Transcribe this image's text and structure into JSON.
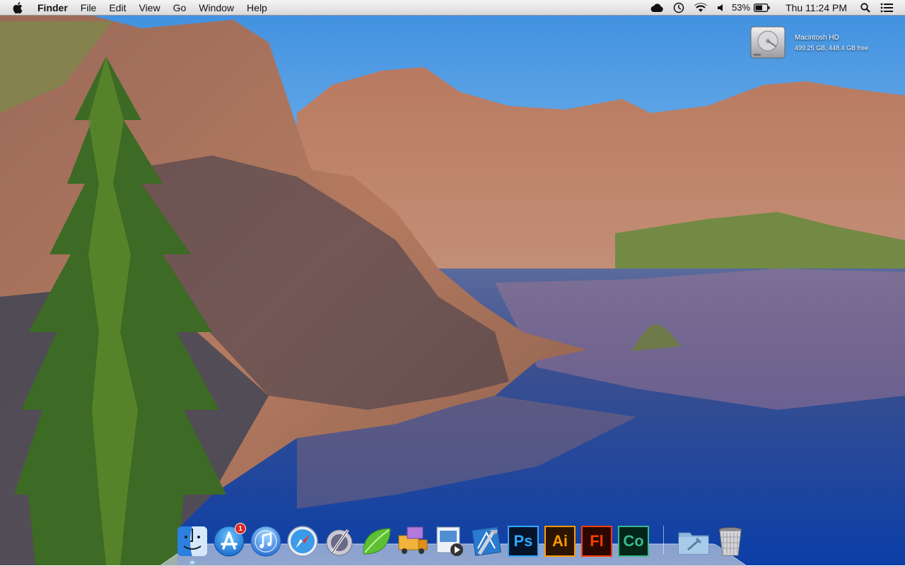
{
  "menubar": {
    "app_name": "Finder",
    "menus": [
      "File",
      "Edit",
      "View",
      "Go",
      "Window",
      "Help"
    ],
    "status": {
      "icons": [
        "cloud-icon",
        "time-machine-icon",
        "wifi-icon",
        "volume-icon"
      ],
      "battery_percent": "53%",
      "clock": "Thu 11:24 PM",
      "extra_icons": [
        "spotlight-icon",
        "notification-center-icon"
      ]
    }
  },
  "desktop": {
    "disk": {
      "name": "Macintosh HD",
      "info": "499.25 GB, 448.4 GB free"
    }
  },
  "dock": {
    "apps": [
      {
        "name": "finder-icon",
        "running": true
      },
      {
        "name": "app-store-icon",
        "badge": "1"
      },
      {
        "name": "itunes-icon"
      },
      {
        "name": "safari-icon"
      },
      {
        "name": "script-editor-icon"
      },
      {
        "name": "coda-icon"
      },
      {
        "name": "transmit-icon"
      },
      {
        "name": "preview-icon"
      },
      {
        "name": "xcode-icon"
      },
      {
        "name": "photoshop-icon",
        "label": "Ps"
      },
      {
        "name": "illustrator-icon",
        "label": "Ai"
      },
      {
        "name": "flash-icon",
        "label": "Fl"
      },
      {
        "name": "edge-code-icon",
        "label": "Co"
      },
      {
        "name": "applications-folder-icon"
      },
      {
        "name": "trash-icon"
      }
    ]
  },
  "colors": {
    "photoshop": "#31a8ff",
    "illustrator": "#ff9a00",
    "flash": "#ff3d00",
    "edge_code": "#3ab98c"
  }
}
